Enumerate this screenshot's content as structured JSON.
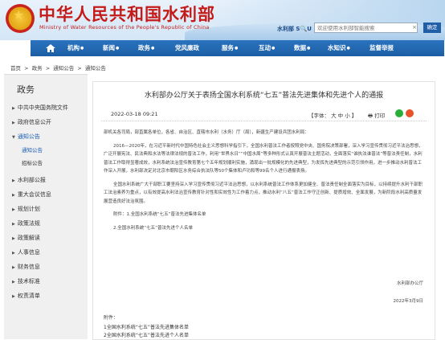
{
  "header": {
    "title": "中华人民共和国水利部",
    "subtitle": "Ministry of Water Resources of the People's Republic of China",
    "search_label": "水利部 S🔍U",
    "search_placeholder": "欢迎使用水利部智能搜索",
    "search_button": "确定",
    "clear_icon": "×"
  },
  "nav": {
    "items": [
      "机构",
      "新闻",
      "政务",
      "党风廉政",
      "服务",
      "互动",
      "数据",
      "水知识",
      "监督举报"
    ]
  },
  "breadcrumb": [
    "首页",
    ">",
    "政务",
    ">",
    "通知公告",
    ">",
    "通知公告"
  ],
  "sidebar": {
    "title": "政务",
    "items": [
      {
        "label": "中共中央国务院文件"
      },
      {
        "label": "政府信息公开"
      },
      {
        "label": "通知公告",
        "active": true
      },
      {
        "label": "水利部公报"
      },
      {
        "label": "重大会议信息"
      },
      {
        "label": "规划计划"
      },
      {
        "label": "政策法规"
      },
      {
        "label": "政策解读"
      },
      {
        "label": "人事信息"
      },
      {
        "label": "财务信息"
      },
      {
        "label": "技术标准"
      },
      {
        "label": "权责清单"
      }
    ],
    "subitems": [
      {
        "label": "通知公告",
        "active": true
      },
      {
        "label": "招标公告",
        "active": false
      }
    ]
  },
  "article": {
    "title": "水利部办公厅关于表扬全国水利系统“七五”普法先进集体和先进个人的通报",
    "date": "2022-03-18 09:21",
    "font_label": "【字体： 大  中  小 】",
    "print_label": "打印",
    "salutation": "部机关各司局，部直属各单位，各省、自治区、直辖市水利（水务）厅（局），新疆生产建设兵团水利局：",
    "para1": "2016—2020年，在习近平新时代中国特色社会主义思想科学指引下，全国水利普法工作者按照党中央、国务院决策部署，深入学习宣传贯彻习近平法治思想，广泛开展宪法、民法典和水法等法律法规的普法工作，利用“世界水日”“中国水周”等多种形式认真开展普法主题活动，全面落实“谁执法谁普法”等普法责任制，水利普法工作取得显著成效，水利系统法治宣传教育第七个五年规划顺利实施，涌现出一批规模化的先进典型，为发挥先进典型的示范引领作用，进一步推动水利普法工作深入开展，水利部决定对北京市朝阳区水务综合执法队等50个集体和卢功和等99名个人进行通报表扬。",
    "para2": "全国水利系统广大干部职工要坚持深入学习宣传贯彻习近平法治思想，以水利系统普法工作体系更加健全、普法责任制全面落实为目标，以持续提升水利干部职工法治素养为重点，以有效提高水利法治宣传教育针对性和实效性为工作着力点，推动水利“八五”普法工作守正创新、提质增效、全面发展，为新阶段水利高质量发展营造良好法治氛围。",
    "attach1": "附件：1.全国水利系统“七五”普法先进集体名单",
    "attach2": "2.全国水利系统“七五”普法先进个人名单",
    "sign_org": "水利部办公厅",
    "sign_date": "2022年3月9日",
    "attach_head": "附件：",
    "attach_list1": "1全国水利系统“七五”普法先进集体名单",
    "attach_list2": "2全国水利系统“七五”普法先进个人名单"
  },
  "colors": {
    "brand_red": "#c51b18",
    "nav_blue": "#1c5ea5",
    "link_blue": "#1a5fb4"
  }
}
